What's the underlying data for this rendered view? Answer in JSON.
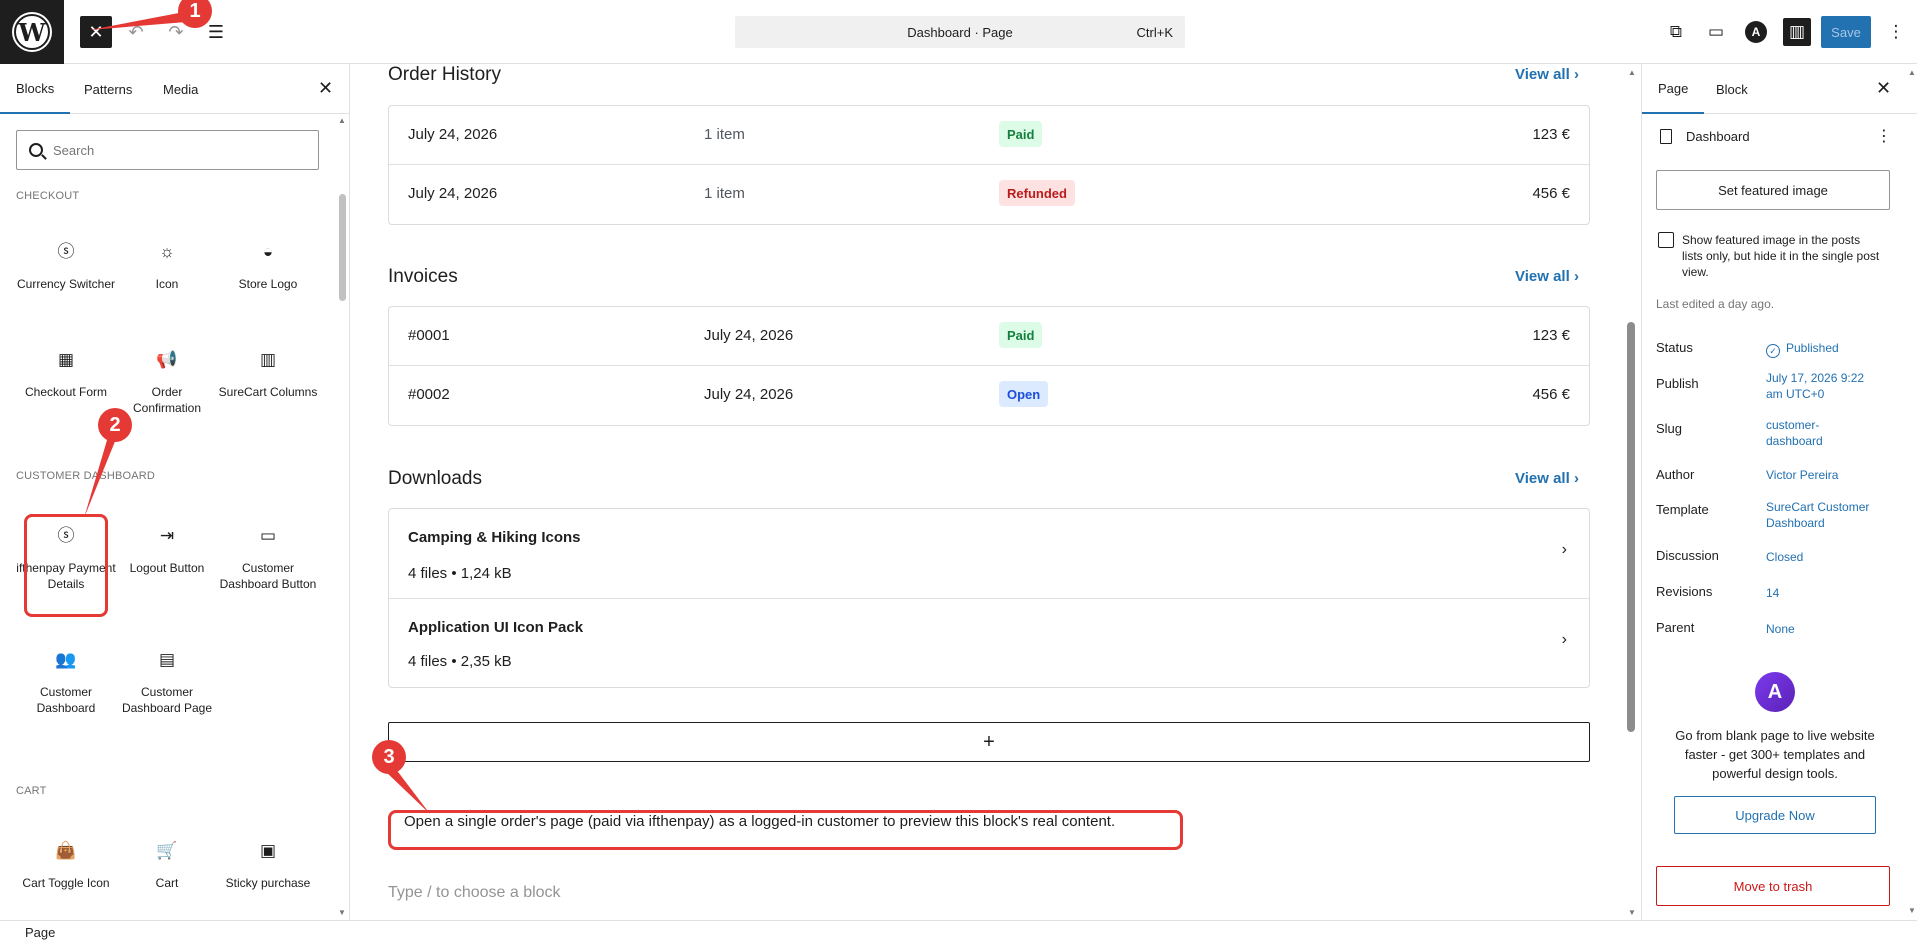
{
  "topbar": {
    "command_label": "Dashboard · Page",
    "command_shortcut": "Ctrl+K",
    "save_label": "Save"
  },
  "inserter": {
    "tabs": [
      "Blocks",
      "Patterns",
      "Media"
    ],
    "search_placeholder": "Search",
    "categories": {
      "checkout": "CHECKOUT",
      "customer_dashboard": "CUSTOMER DASHBOARD",
      "cart": "CART"
    },
    "blocks": {
      "currency_switcher": "Currency Switcher",
      "icon": "Icon",
      "store_logo": "Store Logo",
      "checkout_form": "Checkout Form",
      "order_confirmation": "Order Confirmation",
      "surecart_columns": "SureCart Columns",
      "ifthenpay_payment_details": "ifthenpay Payment Details",
      "logout_button": "Logout Button",
      "customer_dashboard_button": "Customer Dashboard Button",
      "customer_dashboard": "Customer Dashboard",
      "customer_dashboard_page": "Customer Dashboard Page",
      "cart_toggle_icon": "Cart Toggle Icon",
      "cart": "Cart",
      "sticky_purchase": "Sticky purchase"
    }
  },
  "canvas": {
    "order_history": {
      "title": "Order History",
      "view_all": "View all",
      "rows": [
        {
          "date": "July 24, 2026",
          "items": "1 item",
          "status": "Paid",
          "amount": "123 €"
        },
        {
          "date": "July 24, 2026",
          "items": "1 item",
          "status": "Refunded",
          "amount": "456 €"
        }
      ]
    },
    "invoices": {
      "title": "Invoices",
      "view_all": "View all",
      "rows": [
        {
          "number": "#0001",
          "date": "July 24, 2026",
          "status": "Paid",
          "amount": "123 €"
        },
        {
          "number": "#0002",
          "date": "July 24, 2026",
          "status": "Open",
          "amount": "456 €"
        }
      ]
    },
    "downloads": {
      "title": "Downloads",
      "view_all": "View all",
      "rows": [
        {
          "name": "Camping & Hiking Icons",
          "meta": "4 files • 1,24 kB"
        },
        {
          "name": "Application UI Icon Pack",
          "meta": "4 files • 2,35 kB"
        }
      ]
    },
    "notice": "Open a single order's page (paid via ifthenpay) as a logged-in customer to preview this block's real content.",
    "placeholder": "Type / to choose a block"
  },
  "settings": {
    "tabs": [
      "Page",
      "Block"
    ],
    "doc_title": "Dashboard",
    "featured_button": "Set featured image",
    "featured_checkbox": "Show featured image in the posts lists only, but hide it in the single post view.",
    "last_edited": "Last edited a day ago.",
    "meta": {
      "status_label": "Status",
      "status_value": "Published",
      "publish_label": "Publish",
      "publish_value": "July 17, 2026 9:22 am UTC+0",
      "slug_label": "Slug",
      "slug_value": "customer-dashboard",
      "author_label": "Author",
      "author_value": "Victor Pereira",
      "template_label": "Template",
      "template_value": "SureCart Customer Dashboard",
      "discussion_label": "Discussion",
      "discussion_value": "Closed",
      "revisions_label": "Revisions",
      "revisions_value": "14",
      "parent_label": "Parent",
      "parent_value": "None"
    },
    "promo_text": "Go from blank page to live website faster - get 300+ templates and powerful design tools.",
    "upgrade_label": "Upgrade Now",
    "trash_label": "Move to trash"
  },
  "footer": {
    "breadcrumb": "Page"
  },
  "annotations": [
    "1",
    "2",
    "3"
  ]
}
